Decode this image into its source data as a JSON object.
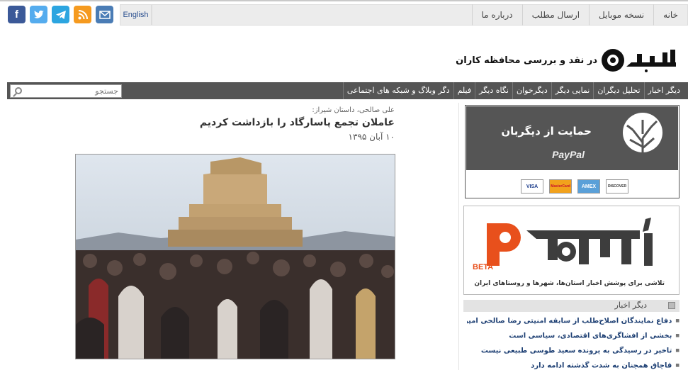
{
  "topbar": {
    "nav": [
      "خانه",
      "نسخه موبایل",
      "ارسال مطلب",
      "درباره ما"
    ],
    "english_label": "English",
    "social_icons": [
      "facebook-icon",
      "twitter-icon",
      "telegram-icon",
      "rss-icon",
      "mail-icon"
    ]
  },
  "header": {
    "logo_text": "دیگربان",
    "tagline": "در نقد و بررسی محافظه کاران"
  },
  "categories": [
    "دیگر اخبار",
    "تحلیل دیگران",
    "نمایی دیگر",
    "دیگرخوان",
    "نگاه دیگر",
    "فیلم",
    "دگر وبلاگ و شبکه های اجتماعی"
  ],
  "search": {
    "placeholder": "جستجو"
  },
  "article": {
    "byline": "علی صالحی، داستان شیراز:",
    "title": "عاملان تجمع پاسارگاد را بازداشت کردیم",
    "date": "۱۰ آبان ۱۳۹۵"
  },
  "sidebar": {
    "support_title": "حمایت از دیگربان",
    "paypal": "PayPal",
    "cards": [
      "VISA",
      "MasterCard",
      "AMEX",
      "DISCOVER"
    ],
    "ad_beta": "BETA",
    "ad_desc": "تلاشی برای پوشش اخبار استان‌ها، شهرها و روستاهای ایران",
    "news_heading": "دیگر اخبار",
    "news": [
      "دفاع نمایندگان اصلاح‌طلب از سابقه امنیتی رضا صالحی امیری",
      "بخشی از افشاگری‌های اقتصادی، سیاسی است",
      "تاخیر در رسیدگی به پرونده سعید طوسی طبیعی نیست",
      "قاچاق همچنان به شدت گذشته ادامه دارد"
    ]
  },
  "colors": {
    "bar": "#555555",
    "nav_bg": "#ececec",
    "link": "#1d3f73",
    "accent": "#e8501c"
  }
}
